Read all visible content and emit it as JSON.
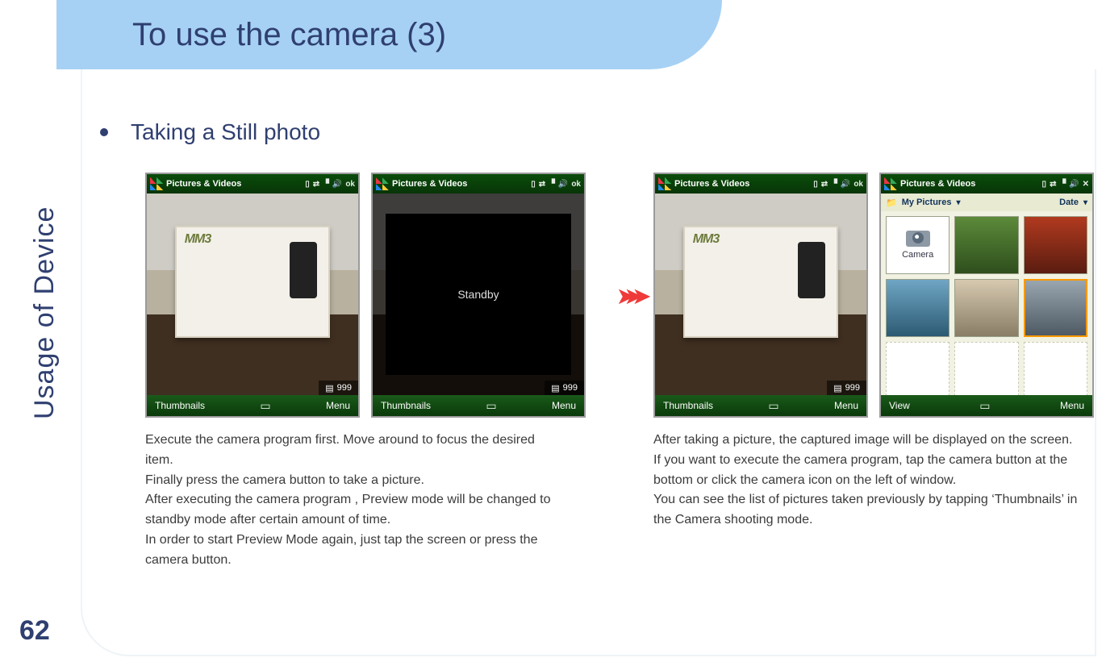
{
  "slide": {
    "title": "To use the camera (3)",
    "side_label": "Usage of Device",
    "page_number": "62",
    "bullet": "Taking a Still photo"
  },
  "phone": {
    "titlebar_app": "Pictures & Videos",
    "titlebar_ok": "ok",
    "titlebar_x": "✕",
    "counter": "999",
    "soft_left": "Thumbnails",
    "soft_right": "Menu",
    "soft_left_alt": "View",
    "standby": "Standby",
    "subbar_left": "My Pictures",
    "subbar_right": "Date",
    "camera_tile": "Camera"
  },
  "caption_left": "Execute  the camera program first. Move around to focus the desired item.\nFinally press the camera button to take a picture.\nAfter executing the camera program , Preview mode will be changed to standby mode after certain amount of time.\nIn order to start Preview Mode again, just tap the screen or press the camera button.",
  "caption_right": "After taking a picture, the captured image will be displayed on the screen.\nIf you want to execute the camera program, tap the camera button at the bottom or click the camera icon on the left of window.\nYou can see the list of pictures taken previously by tapping ‘Thumbnails’ in the Camera shooting mode."
}
